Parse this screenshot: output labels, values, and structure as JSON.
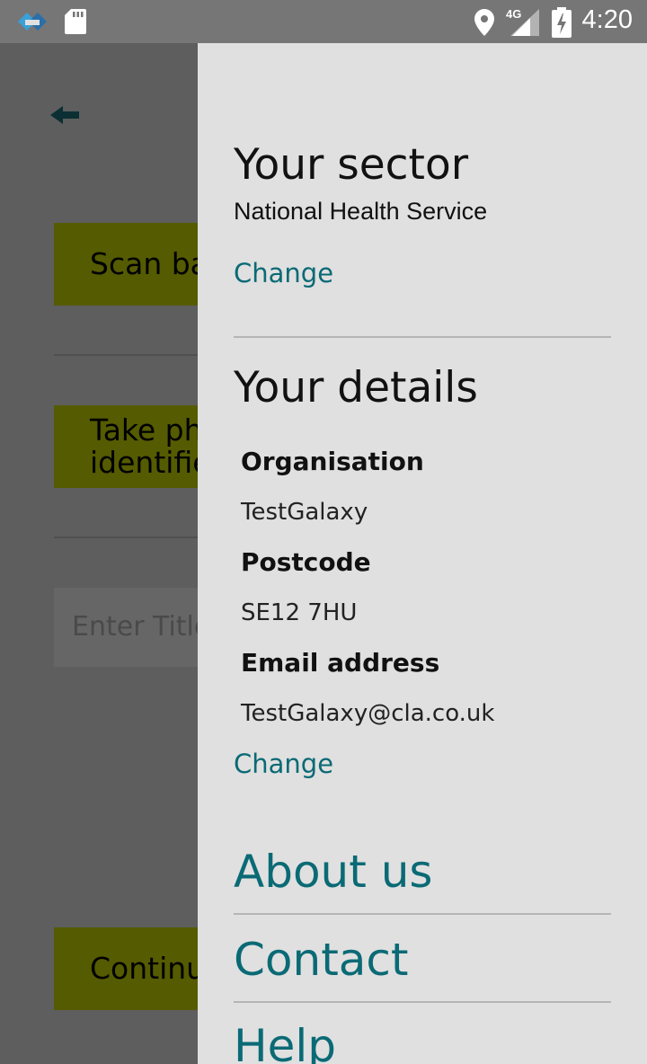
{
  "status_bar": {
    "time": "4:20",
    "network": "4G",
    "icons": [
      "app-notification-icon",
      "sd-card-icon",
      "location-icon",
      "signal-icon",
      "battery-charging-icon"
    ]
  },
  "background": {
    "scan_button": "Scan ba",
    "photo_button": "Take ph identifie",
    "title_placeholder": "Enter Title",
    "continue_button": "Continu",
    "accent_color": "#555b00"
  },
  "drawer": {
    "sector": {
      "heading": "Your sector",
      "value": "National Health Service",
      "change_label": "Change"
    },
    "details": {
      "heading": "Your details",
      "organisation_label": "Organisation",
      "organisation_value": "TestGalaxy",
      "postcode_label": "Postcode",
      "postcode_value": "SE12 7HU",
      "email_label": "Email address",
      "email_value": "TestGalaxy@cla.co.uk",
      "change_label": "Change"
    },
    "nav": {
      "about": "About us",
      "contact": "Contact",
      "help": "Help"
    },
    "link_color": "#0a6a75"
  }
}
